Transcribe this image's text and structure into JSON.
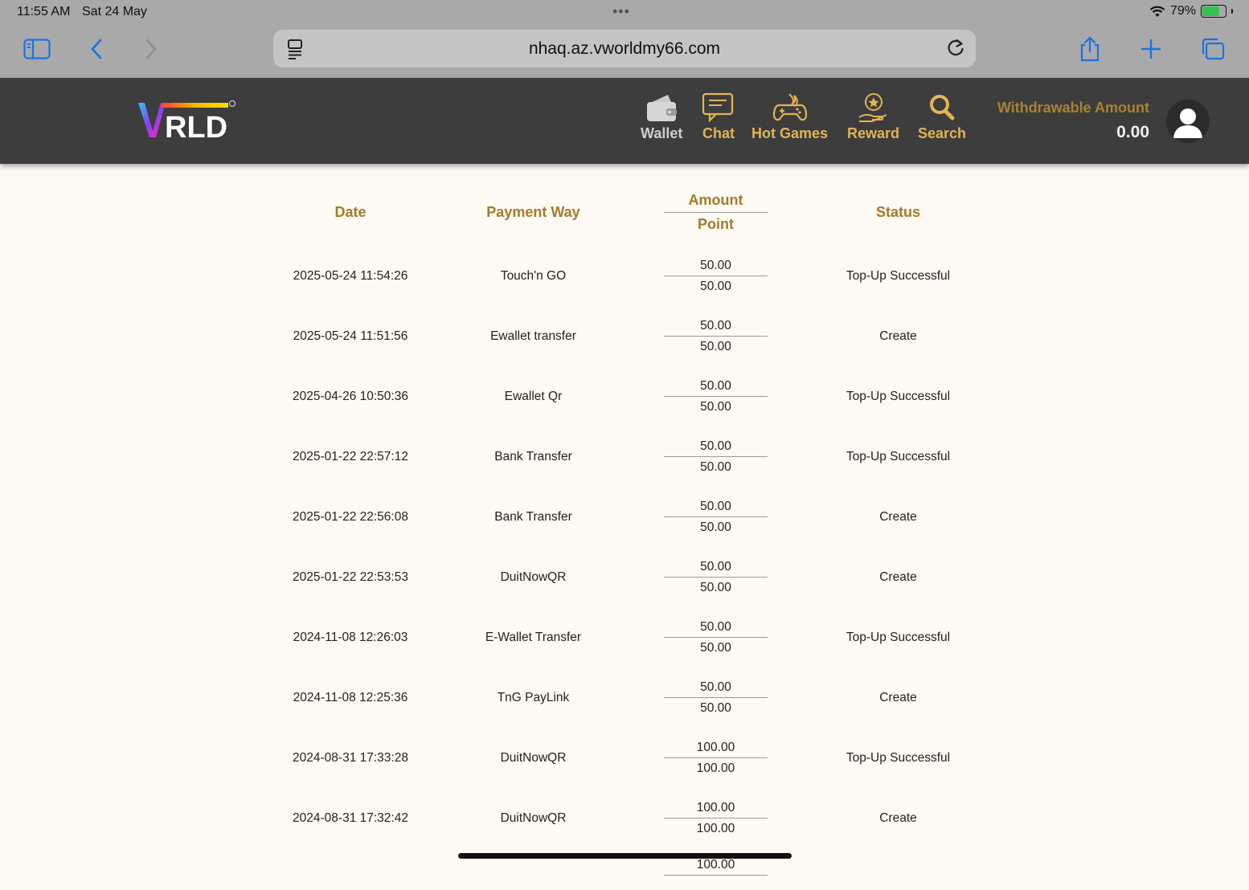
{
  "status_bar": {
    "time": "11:55 AM",
    "date": "Sat 24 May",
    "battery": "79%"
  },
  "browser": {
    "url": "nhaq.az.vworldmy66.com"
  },
  "header": {
    "logo_text": "VRLD",
    "nav": [
      {
        "label": "Wallet"
      },
      {
        "label": "Chat"
      },
      {
        "label": "Hot Games"
      },
      {
        "label": "Reward"
      },
      {
        "label": "Search"
      }
    ],
    "withdrawable_label": "Withdrawable Amount",
    "withdrawable_amount": "0.00"
  },
  "table": {
    "columns": {
      "date": "Date",
      "payment": "Payment Way",
      "amount": "Amount",
      "point": "Point",
      "status": "Status"
    },
    "rows": [
      {
        "date": "2025-05-24 11:54:26",
        "payment": "Touch'n GO",
        "amount": "50.00",
        "point": "50.00",
        "status": "Top-Up Successful"
      },
      {
        "date": "2025-05-24 11:51:56",
        "payment": "Ewallet transfer",
        "amount": "50.00",
        "point": "50.00",
        "status": "Create"
      },
      {
        "date": "2025-04-26 10:50:36",
        "payment": "Ewallet Qr",
        "amount": "50.00",
        "point": "50.00",
        "status": "Top-Up Successful"
      },
      {
        "date": "2025-01-22 22:57:12",
        "payment": "Bank Transfer",
        "amount": "50.00",
        "point": "50.00",
        "status": "Top-Up Successful"
      },
      {
        "date": "2025-01-22 22:56:08",
        "payment": "Bank Transfer",
        "amount": "50.00",
        "point": "50.00",
        "status": "Create"
      },
      {
        "date": "2025-01-22 22:53:53",
        "payment": "DuitNowQR",
        "amount": "50.00",
        "point": "50.00",
        "status": "Create"
      },
      {
        "date": "2024-11-08 12:26:03",
        "payment": "E-Wallet Transfer",
        "amount": "50.00",
        "point": "50.00",
        "status": "Top-Up Successful"
      },
      {
        "date": "2024-11-08 12:25:36",
        "payment": "TnG PayLink",
        "amount": "50.00",
        "point": "50.00",
        "status": "Create"
      },
      {
        "date": "2024-08-31 17:33:28",
        "payment": "DuitNowQR",
        "amount": "100.00",
        "point": "100.00",
        "status": "Top-Up Successful"
      },
      {
        "date": "2024-08-31 17:32:42",
        "payment": "DuitNowQR",
        "amount": "100.00",
        "point": "100.00",
        "status": "Create"
      }
    ],
    "partial_next_amount": "100.00"
  },
  "colors": {
    "accent_gold": "#e3b354",
    "header_gold": "#a57a2b",
    "header_bg": "#3d3d3d",
    "page_bg": "#fdfaf3"
  }
}
